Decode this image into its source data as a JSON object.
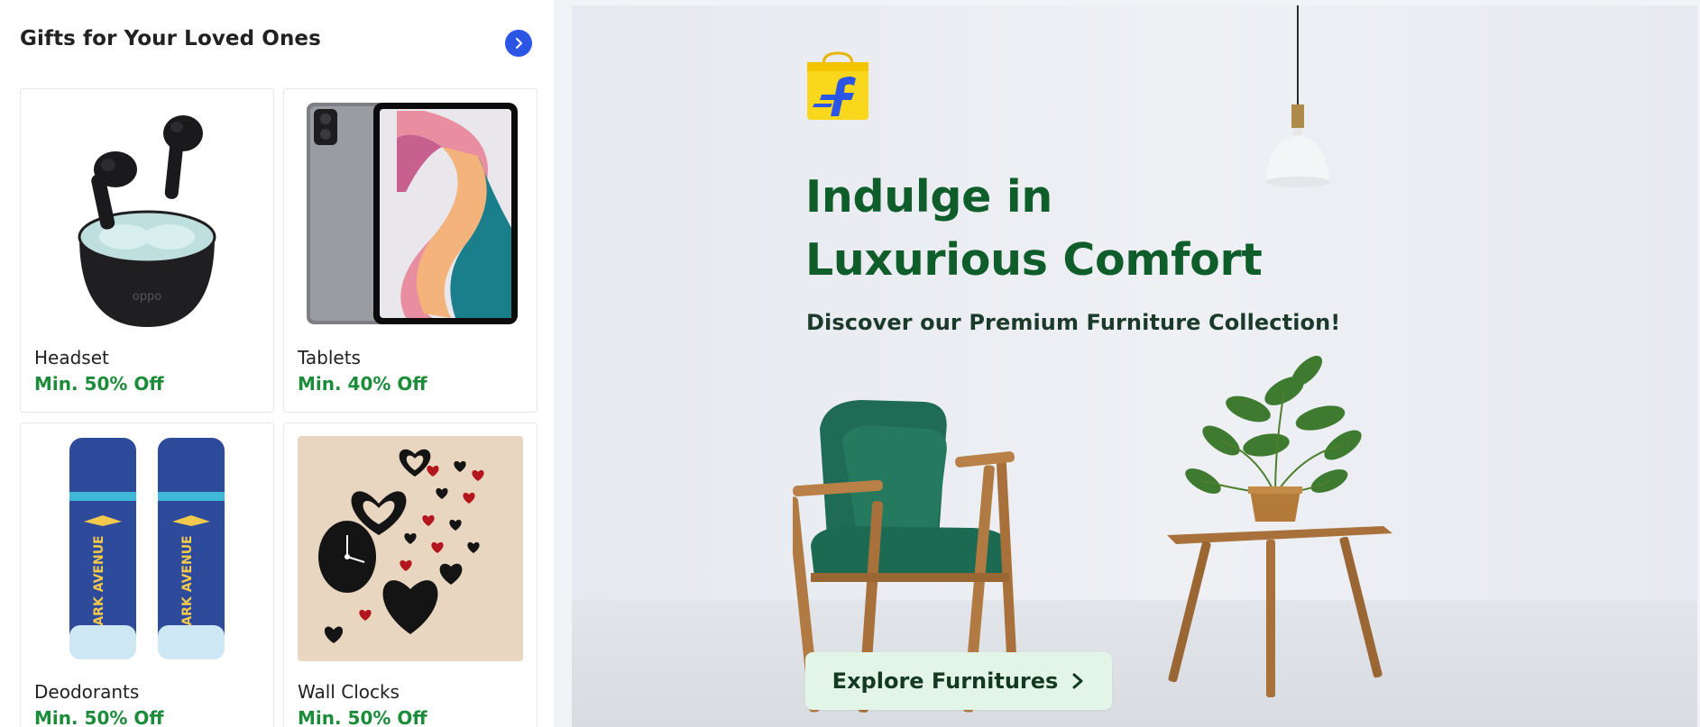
{
  "gifts": {
    "title": "Gifts for Your Loved Ones",
    "arrow_icon": "chevron-right-icon",
    "cards": [
      {
        "name": "Headset",
        "offer": "Min. 50% Off"
      },
      {
        "name": "Tablets",
        "offer": "Min. 40% Off"
      },
      {
        "name": "Deodorants",
        "offer": "Min. 50% Off"
      },
      {
        "name": "Wall Clocks",
        "offer": "Min. 50% Off"
      }
    ],
    "deo_brand_text": "PARK AVENUE"
  },
  "banner": {
    "headline_line1": "Indulge in",
    "headline_line2": "Luxurious Comfort",
    "subheadline": "Discover our Premium Furniture Collection!",
    "cta_label": "Explore Furnitures",
    "cta_icon": "chevron-right-icon",
    "logo_icon": "flipkart-bag-icon"
  },
  "colors": {
    "accent_blue": "#2a55e5",
    "offer_green": "#1c8c3a",
    "headline_green": "#0e5d2a",
    "cta_bg": "#e3f5e7",
    "logo_yellow": "#f9d71c"
  }
}
